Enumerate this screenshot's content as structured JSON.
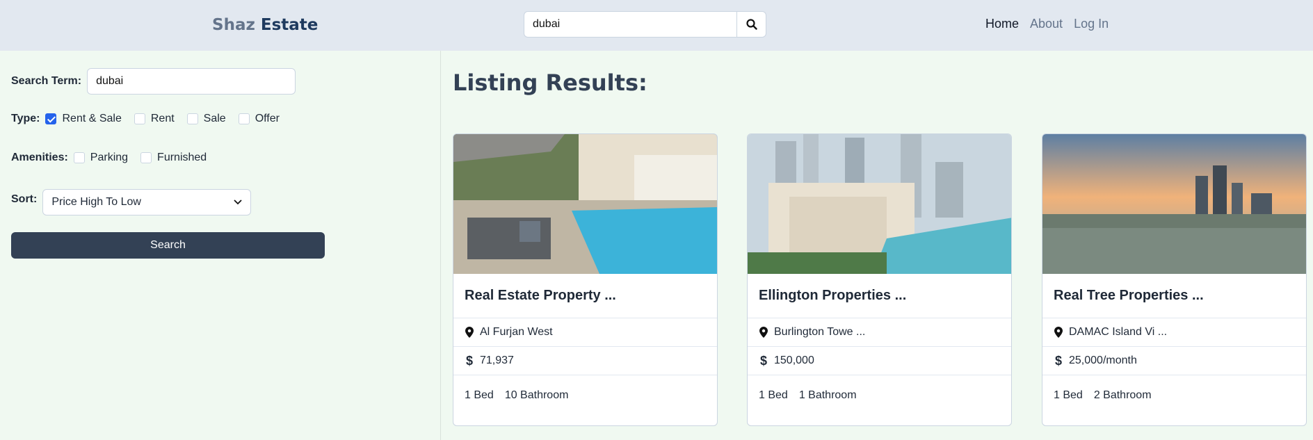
{
  "header": {
    "logo_part1": "Shaz",
    "logo_part2": "Estate",
    "search_value": "dubai",
    "nav": [
      "Home",
      "About",
      "Log In"
    ]
  },
  "sidebar": {
    "search_label": "Search Term:",
    "search_value": "dubai",
    "type_label": "Type:",
    "type_options": [
      {
        "label": "Rent & Sale",
        "checked": true
      },
      {
        "label": "Rent",
        "checked": false
      },
      {
        "label": "Sale",
        "checked": false
      },
      {
        "label": "Offer",
        "checked": false
      }
    ],
    "amenities_label": "Amenities:",
    "amenities_options": [
      {
        "label": "Parking",
        "checked": false
      },
      {
        "label": "Furnished",
        "checked": false
      }
    ],
    "sort_label": "Sort:",
    "sort_value": "Price High To Low",
    "search_button": "Search"
  },
  "main": {
    "title": "Listing Results:",
    "listings": [
      {
        "title": "Real Estate Property ...",
        "location": "Al Furjan West",
        "price": "71,937",
        "beds": "1 Bed",
        "baths": "10 Bathroom"
      },
      {
        "title": "Ellington Properties ...",
        "location": "Burlington Towe ...",
        "price": "150,000",
        "beds": "1 Bed",
        "baths": "1 Bathroom"
      },
      {
        "title": "Real Tree Properties ...",
        "location": "DAMAC Island Vi ...",
        "price": "25,000/month",
        "beds": "1 Bed",
        "baths": "2 Bathroom"
      }
    ]
  },
  "colors": {
    "header_bg": "#e2e8f0",
    "page_bg": "#f0f9f1",
    "primary_button": "#334155",
    "checkbox_checked": "#2563eb"
  },
  "icons": [
    "search-icon",
    "chevron-down-icon",
    "map-pin-icon",
    "dollar-icon"
  ]
}
